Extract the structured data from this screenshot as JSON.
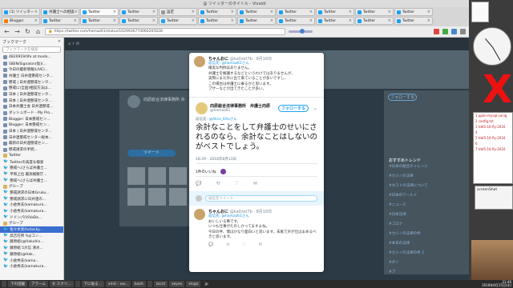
{
  "window": {
    "title": "@ ツイッターのタイトル - Vivaldi"
  },
  "tabs": [
    {
      "label": "(1) ツイッター",
      "color": "#1da1f2",
      "active": false
    },
    {
      "label": "弁護士への相談",
      "color": "#1da1f2",
      "active": false
    },
    {
      "label": "Twitter",
      "color": "#1da1f2",
      "active": true
    },
    {
      "label": "Twitter",
      "color": "#1da1f2",
      "active": false
    },
    {
      "label": "設定",
      "color": "#999999",
      "active": false
    },
    {
      "label": "Twitter",
      "color": "#1da1f2",
      "active": false
    },
    {
      "label": "Twitter",
      "color": "#1da1f2",
      "active": false
    },
    {
      "label": "Twitter",
      "color": "#1da1f2",
      "active": false
    },
    {
      "label": "Twitter",
      "color": "#1da1f2",
      "active": false
    },
    {
      "label": "Twitter",
      "color": "#1da1f2",
      "active": false
    },
    {
      "label": "Twitter",
      "color": "#1da1f2",
      "active": false
    },
    {
      "label": "Blogger",
      "color": "#f57d00",
      "active": false
    },
    {
      "label": "Twitter",
      "color": "#1da1f2",
      "active": false
    },
    {
      "label": "Twitter",
      "color": "#1da1f2",
      "active": false
    },
    {
      "label": "Twitter",
      "color": "#1da1f2",
      "active": false
    },
    {
      "label": "Twitter",
      "color": "#1da1f2",
      "active": false
    },
    {
      "label": "Twitter",
      "color": "#1da1f2",
      "active": false
    },
    {
      "label": "Twitter",
      "color": "#1da1f2",
      "active": false
    },
    {
      "label": "Twitter",
      "color": "#1da1f2",
      "active": false
    },
    {
      "label": "Twitter",
      "color": "#1da1f2",
      "active": false
    },
    {
      "label": "Twitter",
      "color": "#1da1f2",
      "active": false
    },
    {
      "label": "Twitter",
      "color": "#1da1f2",
      "active": false
    }
  ],
  "nav": {
    "url": "https://twitter.com/hamaz61/status/1029936774060265628",
    "back": "←",
    "forward": "→",
    "reload": "↻",
    "home": "⌂"
  },
  "sidebar": {
    "title": "ブックマーク",
    "search_placeholder": "ブックマークを検索",
    "items": [
      {
        "label": "4820919/life at modo...",
        "type": "link"
      },
      {
        "label": "SIBIN/Signalon(仮)(...",
        "type": "link"
      },
      {
        "label": "今日の最新情報(LIVE)...",
        "type": "link"
      },
      {
        "label": "弁護士 日弁連懲戒センタ...",
        "type": "link"
      },
      {
        "label": "懲戒 | 日弁連懲戒センタ...",
        "type": "link"
      },
      {
        "label": "懲戒に(全国)相談方法は...",
        "type": "link"
      },
      {
        "label": "日本 | 日弁連懲戒センタ...",
        "type": "link"
      },
      {
        "label": "日本 | 日弁連懲戒センタ...",
        "type": "link"
      },
      {
        "label": "日本弁護士会 日弁連懲戒...",
        "type": "link"
      },
      {
        "label": "ダッシュボード - My Pro...",
        "type": "link"
      },
      {
        "label": "Blogger: 日本懲戒セン...",
        "type": "link"
      },
      {
        "label": "Blogger: 日本懲戒セン...",
        "type": "link"
      },
      {
        "label": "日本 | 日弁連懲戒センタ...",
        "type": "link"
      },
      {
        "label": "日弁連懲戒センター総本...",
        "type": "link"
      },
      {
        "label": "最新の日弁連懲戒セン...",
        "type": "link"
      },
      {
        "label": "懲戒請求の手続...",
        "type": "link"
      },
      {
        "label": "Twitter",
        "type": "folder"
      },
      {
        "label": "Twitterの高度な検索",
        "type": "tw"
      },
      {
        "label": "懲戒へ(さらば弁護士...",
        "type": "tw"
      },
      {
        "label": "平和上位 最高検察庁...",
        "type": "tw"
      },
      {
        "label": "懲戒へ(さらば弁護士...",
        "type": "tw"
      },
      {
        "label": "グループ",
        "type": "folder"
      },
      {
        "label": "懲戒請求の日本Gruku...",
        "type": "tw"
      },
      {
        "label": "懲戒請求に日弁連の...",
        "type": "tw"
      },
      {
        "label": "小倉秀夫(kamakura...",
        "type": "tw"
      },
      {
        "label": "小倉秀夫(kamakura...",
        "type": "tw"
      },
      {
        "label": "ドドンパ(ViVaDa...",
        "type": "tw"
      },
      {
        "label": "グループ",
        "type": "folder"
      },
      {
        "label": "佐々木亮(hotacky...",
        "type": "tw",
        "selected": true
      },
      {
        "label": "高吉在所 Yujiコン...",
        "type": "tw"
      },
      {
        "label": "藤原総(@Hakuhin...",
        "type": "tw"
      },
      {
        "label": "藤原総 5大信 清水...",
        "type": "tw"
      },
      {
        "label": "藤原総(@Hak...",
        "type": "tw"
      },
      {
        "label": "小倉秀夫(kama...",
        "type": "tw"
      },
      {
        "label": "小倉秀夫(kamakura...",
        "type": "tw"
      }
    ]
  },
  "background": {
    "profile_name": "向原総合法律事務所 弁",
    "tweet_button": "ツイート",
    "follow_button": "フォローする",
    "trends_title": "おすすめトレンド",
    "trends": [
      "#日本の総合チャレンジ",
      "#カジノの法律",
      "#ホストの法律について",
      "#日本のワールド",
      "#ニュース",
      "#日本法律",
      "#コロナ",
      "#カジノの法律の件",
      "#本日の法律",
      "#カジノの法律の件 2",
      "#ボイ",
      "#プ"
    ]
  },
  "modal": {
    "top_reply": {
      "name": "ちゃんおに",
      "meta": "@ka0zet7b · 8月18日",
      "reply_to": "返信先: @hamaz61さん",
      "lines": [
        "確実な判例はありません。",
        "弁護士を擁護するなどというわけではありませんが、",
        "実際にまだ外に出て来ていることが多いですし、",
        "この場合は弁護士に乗るかと思います。",
        ""
      ],
      "footer": "ブザーなどが出てきたことが多い。"
    },
    "main": {
      "name": "向原総合法律事務所　弁護士向原",
      "handle": "@hamaz61",
      "follow_label": "フォローする",
      "reply_to_label": "返信先:",
      "reply_to_handle": "@Alice_Kitoさん",
      "text": "余計なことをして弁護士のせいにされるのなら、余計なことはしないのがベストでしょう。",
      "time": "18:29 - 2018年8月13日",
      "likes": "1件のいいね",
      "actions": [
        "💬",
        "⟲",
        "♡",
        "✉"
      ]
    },
    "reply_box_placeholder": "返信をツイート",
    "bottom_reply": {
      "name": "ちゃんおに",
      "meta": "@ka0zet7b · 8月18日",
      "reply_to": "返信先: @hamaz61さん",
      "lines": [
        "おいしいる事です。",
        "いつも仕事がたのしかってますよね。",
        "",
        "今日の件、僕はかなり面白いと思います。末尾で声が仕はまめるべきと思います。"
      ],
      "actions": [
        "💬",
        "⟲",
        "♡",
        "✉"
      ]
    }
  },
  "desktop": {
    "window_lines": [
      "1 ppkir-mysql-conig",
      "2 config.txt",
      "3 tdd5-16-fly-2016",
      "4",
      "5 tdd5-16-fly-2016",
      "6",
      "7 tdd5-16-fly-2016"
    ],
    "window2_title": "screenShot"
  },
  "taskbar": {
    "items": [
      "",
      "下の田園",
      "アラーム",
      "Ⓑ スクリ...",
      "",
      "下に貼る...",
      "xlnG - xw...",
      "bash",
      "",
      "zscct",
      "xeyes",
      "xlogo"
    ],
    "lang": "jp",
    "time": "21:46",
    "date": "2018年8月15日(水)"
  },
  "colors": {
    "accent": "#1da1f2",
    "selection": "#3a6fd0"
  }
}
